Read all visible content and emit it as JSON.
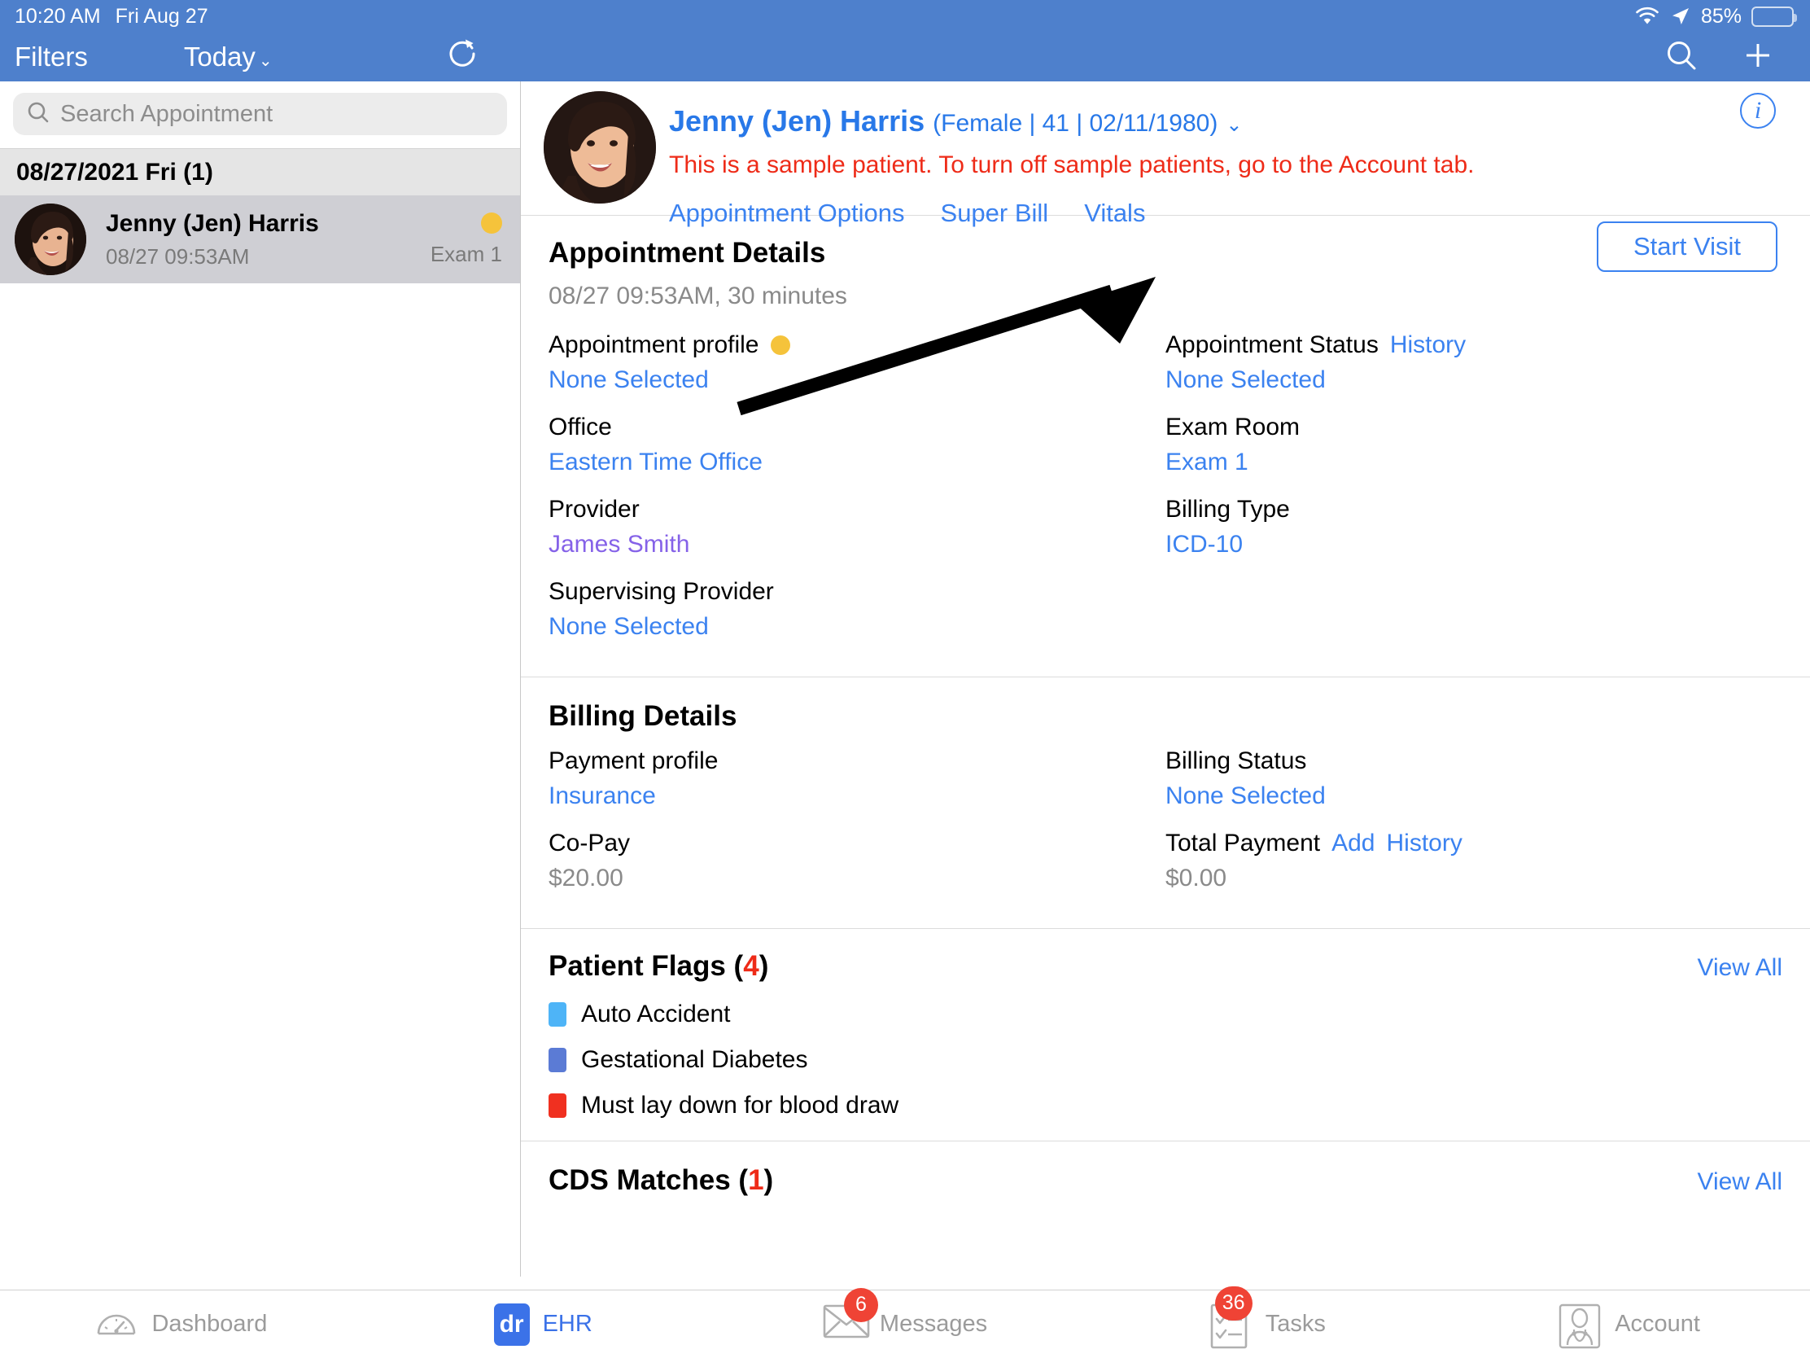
{
  "status_bar": {
    "time": "10:20 AM",
    "date": "Fri Aug 27",
    "battery_percent": "85%",
    "wifi_icon": "wifi-icon",
    "location_icon": "location-arrow-icon",
    "battery_icon": "battery-icon"
  },
  "nav": {
    "filters_label": "Filters",
    "today_label": "Today",
    "today_chevron": "⌄",
    "refresh_icon": "refresh-icon",
    "search_icon": "search-icon",
    "add_icon": "plus-icon",
    "bar_color": "#4e80cc"
  },
  "sidebar": {
    "search": {
      "placeholder": "Search Appointment",
      "value": "",
      "icon": "search-icon"
    },
    "date_header": "08/27/2021 Fri (1)",
    "appointments": [
      {
        "name": "Jenny (Jen) Harris",
        "time": "08/27 09:53AM",
        "room": "Exam 1",
        "status_dot_color": "#f5c33b"
      }
    ]
  },
  "patient_header": {
    "name": "Jenny (Jen) Harris",
    "meta": "(Female | 41 | 02/11/1980)",
    "chevron": "⌄",
    "sample_warning": "This is a sample patient. To turn off sample patients, go to the Account tab.",
    "warning_color": "#ee2b18",
    "links": [
      {
        "label": "Appointment Options",
        "name": "appointment-options-link"
      },
      {
        "label": "Super Bill",
        "name": "super-bill-link"
      },
      {
        "label": "Vitals",
        "name": "vitals-link"
      }
    ],
    "info_icon": "info-icon",
    "start_visit_label": "Start Visit"
  },
  "appointment_details": {
    "title": "Appointment Details",
    "subtitle": "08/27 09:53AM, 30 minutes",
    "left_fields": [
      {
        "label": "Appointment profile",
        "value": "None Selected",
        "value_style": "link",
        "dot": "#f5c33b"
      },
      {
        "label": "Office",
        "value": "Eastern Time Office",
        "value_style": "link"
      },
      {
        "label": "Provider",
        "value": "James Smith",
        "value_style": "purple"
      },
      {
        "label": "Supervising Provider",
        "value": "None Selected",
        "value_style": "link"
      }
    ],
    "right_fields": [
      {
        "label": "Appointment Status",
        "action": "History",
        "value": "None Selected",
        "value_style": "link"
      },
      {
        "label": "Exam Room",
        "value": "Exam 1",
        "value_style": "link"
      },
      {
        "label": "Billing Type",
        "value": "ICD-10",
        "value_style": "link"
      }
    ]
  },
  "billing_details": {
    "title": "Billing Details",
    "left_fields": [
      {
        "label": "Payment profile",
        "value": "Insurance",
        "value_style": "link"
      },
      {
        "label": "Co-Pay",
        "value": "$20.00",
        "value_style": "grey"
      }
    ],
    "right_fields": [
      {
        "label": "Billing Status",
        "value": "None Selected",
        "value_style": "link"
      },
      {
        "label": "Total Payment",
        "action": "Add",
        "action2": "History",
        "value": "$0.00",
        "value_style": "grey"
      }
    ]
  },
  "patient_flags": {
    "title": "Patient Flags (",
    "count": "4",
    "title_end": ")",
    "view_all": "View All",
    "items": [
      {
        "label": "Auto Accident",
        "color": "#4eb4f7"
      },
      {
        "label": "Gestational Diabetes",
        "color": "#5b7bd5"
      },
      {
        "label": "Must lay down for blood draw",
        "color": "#f03020"
      }
    ]
  },
  "cds_matches": {
    "title": "CDS Matches (",
    "count": "1",
    "title_end": ")",
    "view_all": "View All"
  },
  "tabbar": {
    "tabs": [
      {
        "label": "Dashboard",
        "icon": "gauge-icon",
        "active": false,
        "badge": ""
      },
      {
        "label": "EHR",
        "icon": "dr-logo-icon",
        "active": true,
        "badge": ""
      },
      {
        "label": "Messages",
        "icon": "envelope-icon",
        "active": false,
        "badge": "6"
      },
      {
        "label": "Tasks",
        "icon": "checklist-icon",
        "active": false,
        "badge": "36"
      },
      {
        "label": "Account",
        "icon": "doctor-icon",
        "active": false,
        "badge": ""
      }
    ],
    "badge_color": "#ef4335",
    "active_color": "#3b72e8"
  }
}
